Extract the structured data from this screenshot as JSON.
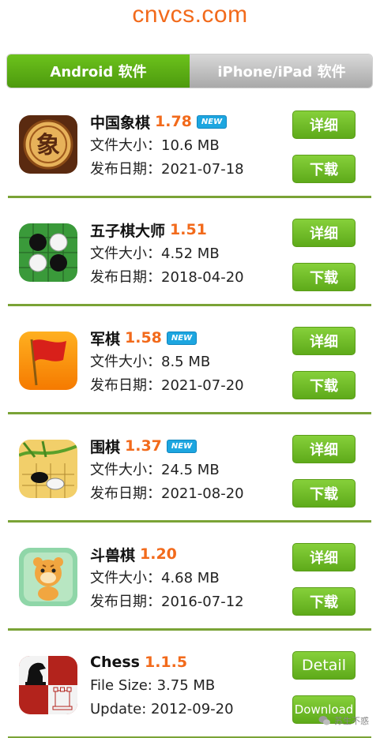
{
  "site": {
    "title": "cnvcs.com"
  },
  "tabs": [
    {
      "label": "Android 软件",
      "active": true
    },
    {
      "label": "iPhone/iPad 软件",
      "active": false
    }
  ],
  "colors": {
    "accent": "#f26a1b",
    "green": "#5eaa1a",
    "badge": "#1da6e0",
    "divider": "#7aa336"
  },
  "apps": [
    {
      "name": "中国象棋",
      "version": "1.78",
      "new": "NEW",
      "size": "文件大小：10.6 MB",
      "date": "发布日期：2021-07-18",
      "detail": "详细",
      "download": "下载",
      "icon": "xiangqi-icon"
    },
    {
      "name": "五子棋大师",
      "version": "1.51",
      "new": "",
      "size": "文件大小：4.52 MB",
      "date": "发布日期：2018-04-20",
      "detail": "详细",
      "download": "下载",
      "icon": "gomoku-icon"
    },
    {
      "name": "军棋",
      "version": "1.58",
      "new": "NEW",
      "size": "文件大小：8.5 MB",
      "date": "发布日期：2021-07-20",
      "detail": "详细",
      "download": "下载",
      "icon": "flag-icon"
    },
    {
      "name": "围棋",
      "version": "1.37",
      "new": "NEW",
      "size": "文件大小：24.5 MB",
      "date": "发布日期：2021-08-20",
      "detail": "详细",
      "download": "下载",
      "icon": "go-icon"
    },
    {
      "name": "斗兽棋",
      "version": "1.20",
      "new": "",
      "size": "文件大小：4.68 MB",
      "date": "发布日期：2016-07-12",
      "detail": "详细",
      "download": "下载",
      "icon": "tiger-icon"
    },
    {
      "name": "Chess",
      "version": "1.1.5",
      "new": "",
      "size": "File Size: 3.75 MB",
      "date": "Update: 2012-09-20",
      "detail": "Detail",
      "download": "Download",
      "icon": "chess-icon"
    }
  ],
  "watermark": {
    "text": "苏生不惑"
  }
}
